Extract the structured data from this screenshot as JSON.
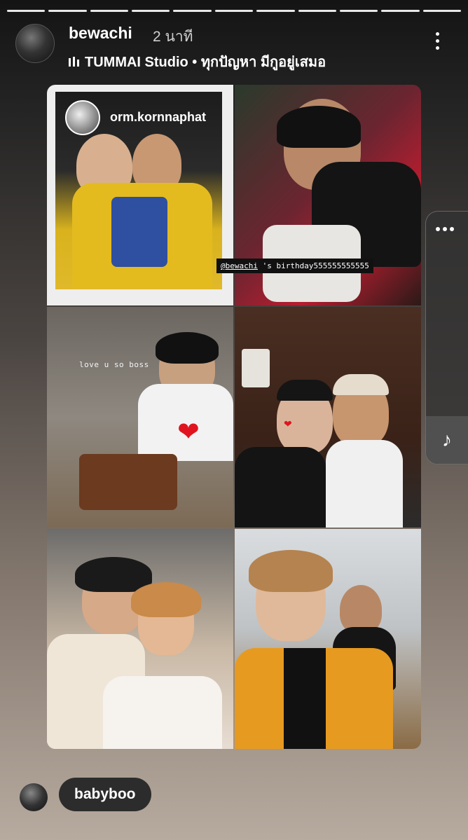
{
  "progress_segments": 11,
  "header": {
    "username": "bewachi",
    "time": "2 นาที",
    "music": "TUMMAI Studio • ทุกปัญหา มีกูอยู่เสมอ"
  },
  "collage": {
    "inner_story_username": "orm.kornnaphat",
    "caption_mention": "@bewachi",
    "caption_text": " 's birthday555555555555",
    "handwritten_text": "love u so boss"
  },
  "reply": {
    "text": "babyboo"
  }
}
